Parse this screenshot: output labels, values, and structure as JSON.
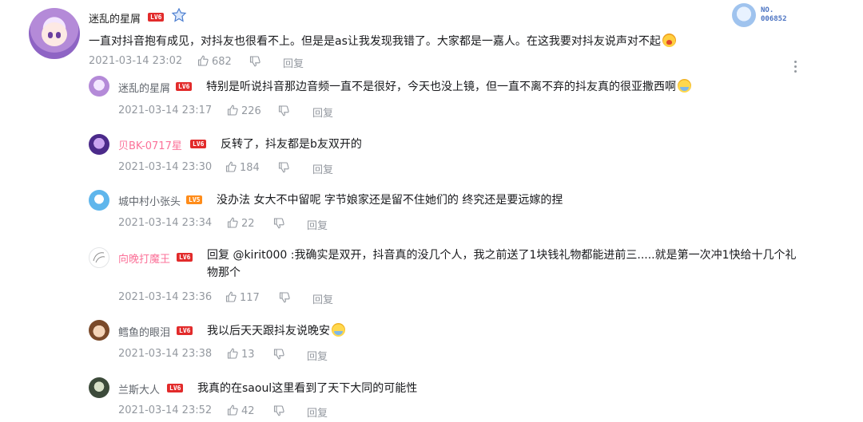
{
  "main_comment": {
    "username": "迷乱的星屑",
    "level": "LV6",
    "nameplate": {
      "no_label": "NO.",
      "number": "006852"
    },
    "text": "一直对抖音抱有成见，对抖友也很看不上。但是是as让我发现我错了。大家都是一嘉人。在这我要对抖友说声对不起",
    "emoji": "crying-emoji",
    "time": "2021-03-14 23:02",
    "likes": "682",
    "reply_label": "回复"
  },
  "replies": [
    {
      "username": "迷乱的星屑",
      "level": "LV6",
      "text": "特别是听说抖音那边音频一直不是很好，今天也没上镜，但一直不离不弃的抖友真的很亚撒西啊",
      "emoji": "smile-emoji",
      "time": "2021-03-14 23:17",
      "likes": "226",
      "reply_label": "回复"
    },
    {
      "username": "贝BK-0717星",
      "level": "LV6",
      "text": "反转了，抖友都是b友双开的",
      "time": "2021-03-14 23:30",
      "likes": "184",
      "reply_label": "回复"
    },
    {
      "username": "城中村小张头",
      "level": "LV5",
      "text": "没办法 女大不中留呢 字节娘家还是留不住她们的 终究还是要远嫁的捏",
      "time": "2021-03-14 23:34",
      "likes": "22",
      "reply_label": "回复"
    },
    {
      "username": "向晚打魔王",
      "level": "LV6",
      "text": "回复 @kirit000 :我确实是双开，抖音真的没几个人，我之前送了1块钱礼物都能进前三.....就是第一次冲1快给十几个礼物那个",
      "time": "2021-03-14 23:36",
      "likes": "117",
      "reply_label": "回复"
    },
    {
      "username": "鳕鱼的眼泪",
      "level": "LV6",
      "text": "我以后天天跟抖友说晚安",
      "emoji": "smile-emoji",
      "time": "2021-03-14 23:38",
      "likes": "13",
      "reply_label": "回复"
    },
    {
      "username": "兰斯大人",
      "level": "LV6",
      "text": "我真的在saoul这里看到了天下大同的可能性",
      "time": "2021-03-14 23:52",
      "likes": "42",
      "reply_label": "回复"
    }
  ],
  "colors": {
    "level_red": "#e22b2b",
    "level_orange": "#ff8c1a",
    "vip_name": "#fb7299",
    "meta_gray": "#9499a0"
  }
}
